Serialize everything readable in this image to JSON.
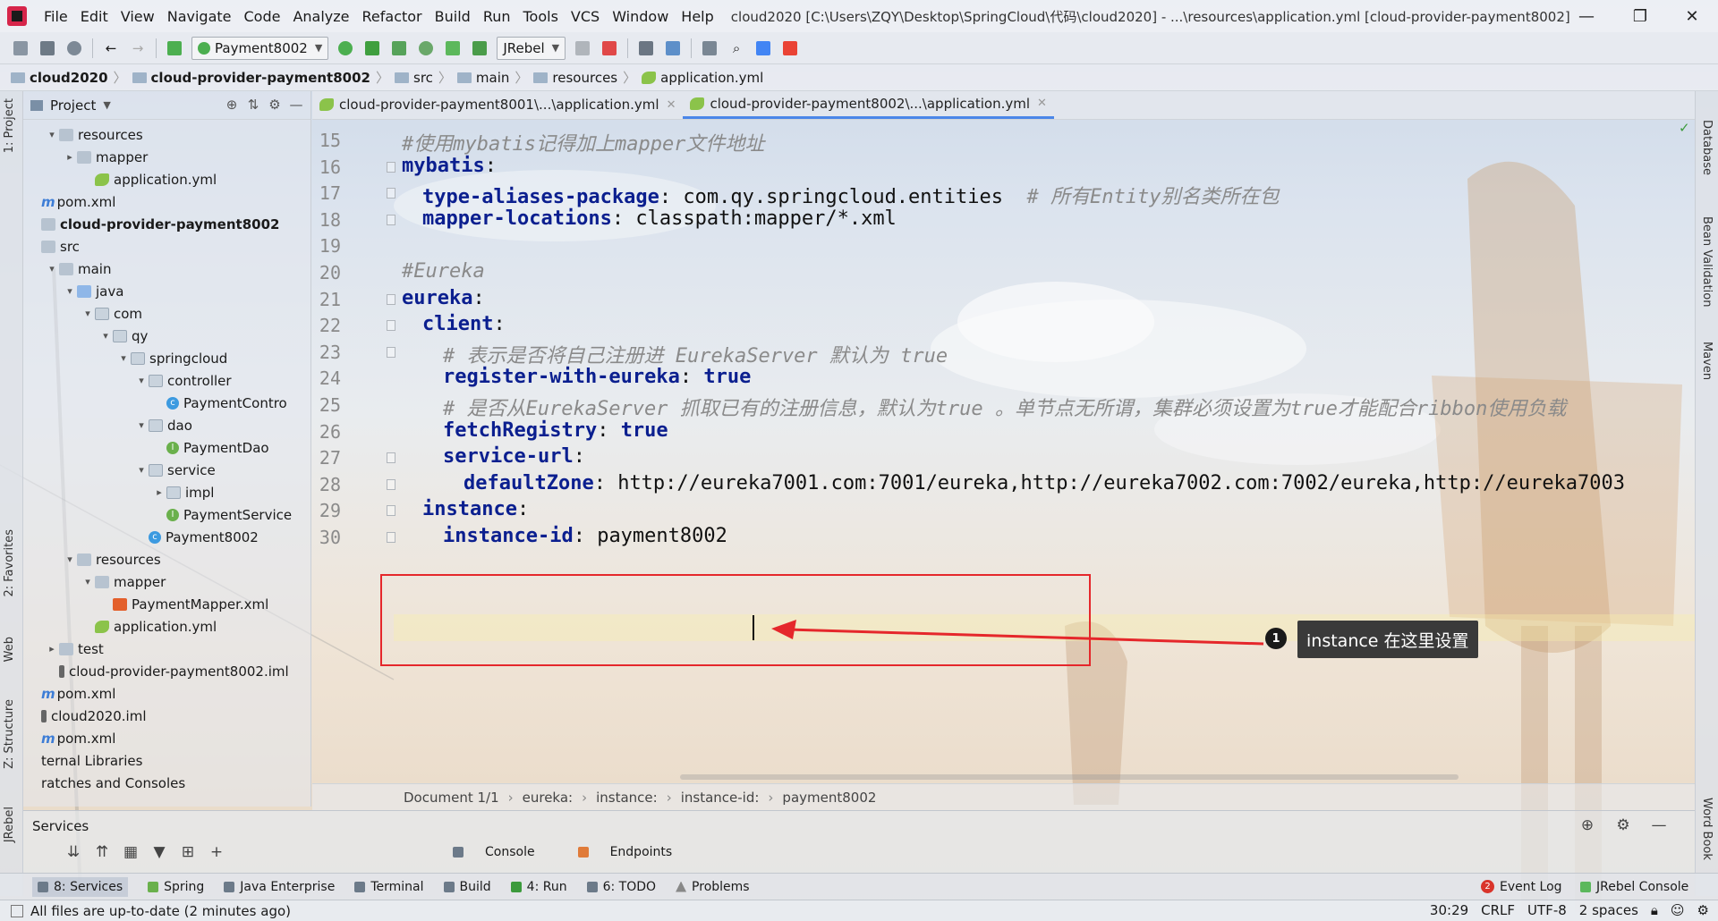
{
  "window": {
    "title": "cloud2020 [C:\\Users\\ZQY\\Desktop\\SpringCloud\\代码\\cloud2020] - ...\\resources\\application.yml [cloud-provider-payment8002]",
    "minimize": "—",
    "restore": "❐",
    "close": "✕"
  },
  "menu": [
    "File",
    "Edit",
    "View",
    "Navigate",
    "Code",
    "Analyze",
    "Refactor",
    "Build",
    "Run",
    "Tools",
    "VCS",
    "Window",
    "Help"
  ],
  "toolbar": {
    "run_config": "Payment8002",
    "jrebel_select": "JRebel"
  },
  "breadcrumb": [
    "cloud2020",
    "cloud-provider-payment8002",
    "src",
    "main",
    "resources",
    "application.yml"
  ],
  "left_stripe": [
    "1: Project",
    "2: Favorites",
    "Web",
    "Z: Structure",
    "JRebel"
  ],
  "right_stripe": [
    "Database",
    "Bean Validation",
    "Maven",
    "Word Book"
  ],
  "project_panel": {
    "title": "Project",
    "tree": [
      {
        "label": "resources",
        "depth": 1,
        "icon": "folder",
        "arrow": "down"
      },
      {
        "label": "mapper",
        "depth": 2,
        "icon": "folder",
        "arrow": "right"
      },
      {
        "label": "application.yml",
        "depth": 3,
        "icon": "yml",
        "arrow": ""
      },
      {
        "label": "pom.xml",
        "depth": 0,
        "icon": "m",
        "arrow": ""
      },
      {
        "label": "cloud-provider-payment8002",
        "depth": 0,
        "icon": "module",
        "arrow": "",
        "bold": true
      },
      {
        "label": "src",
        "depth": 0,
        "icon": "folder",
        "arrow": ""
      },
      {
        "label": "main",
        "depth": 1,
        "icon": "folder",
        "arrow": "down"
      },
      {
        "label": "java",
        "depth": 2,
        "icon": "src",
        "arrow": "down"
      },
      {
        "label": "com",
        "depth": 3,
        "icon": "pkg",
        "arrow": "down"
      },
      {
        "label": "qy",
        "depth": 4,
        "icon": "pkg",
        "arrow": "down"
      },
      {
        "label": "springcloud",
        "depth": 5,
        "icon": "pkg",
        "arrow": "down"
      },
      {
        "label": "controller",
        "depth": 6,
        "icon": "pkg",
        "arrow": "down"
      },
      {
        "label": "PaymentContro",
        "depth": 7,
        "icon": "c",
        "arrow": ""
      },
      {
        "label": "dao",
        "depth": 6,
        "icon": "pkg",
        "arrow": "down"
      },
      {
        "label": "PaymentDao",
        "depth": 7,
        "icon": "i",
        "arrow": ""
      },
      {
        "label": "service",
        "depth": 6,
        "icon": "pkg",
        "arrow": "down"
      },
      {
        "label": "impl",
        "depth": 7,
        "icon": "pkg",
        "arrow": "right"
      },
      {
        "label": "PaymentService",
        "depth": 7,
        "icon": "i",
        "arrow": ""
      },
      {
        "label": "Payment8002",
        "depth": 6,
        "icon": "c",
        "arrow": ""
      },
      {
        "label": "resources",
        "depth": 2,
        "icon": "folder",
        "arrow": "down"
      },
      {
        "label": "mapper",
        "depth": 3,
        "icon": "folder",
        "arrow": "down"
      },
      {
        "label": "PaymentMapper.xml",
        "depth": 4,
        "icon": "xml",
        "arrow": ""
      },
      {
        "label": "application.yml",
        "depth": 3,
        "icon": "yml",
        "arrow": ""
      },
      {
        "label": "test",
        "depth": 1,
        "icon": "folder",
        "arrow": "right"
      },
      {
        "label": "cloud-provider-payment8002.iml",
        "depth": 1,
        "icon": "iml",
        "arrow": ""
      },
      {
        "label": "pom.xml",
        "depth": 0,
        "icon": "m",
        "arrow": ""
      },
      {
        "label": "cloud2020.iml",
        "depth": 0,
        "icon": "iml",
        "arrow": ""
      },
      {
        "label": "pom.xml",
        "depth": 0,
        "icon": "m",
        "arrow": ""
      },
      {
        "label": "ternal Libraries",
        "depth": 0,
        "icon": "",
        "arrow": ""
      },
      {
        "label": "ratches and Consoles",
        "depth": 0,
        "icon": "",
        "arrow": ""
      }
    ]
  },
  "editor": {
    "tabs": [
      {
        "label": "cloud-provider-payment8001\\...\\application.yml",
        "active": false
      },
      {
        "label": "cloud-provider-payment8002\\...\\application.yml",
        "active": true
      }
    ],
    "lines": [
      {
        "n": "15",
        "indent": 0,
        "parts": [
          {
            "t": "#使用mybatis记得加上mapper文件地址",
            "c": "cm"
          }
        ]
      },
      {
        "n": "16",
        "indent": 0,
        "parts": [
          {
            "t": "mybatis",
            "c": "k"
          },
          {
            "t": ":",
            "c": ""
          }
        ]
      },
      {
        "n": "17",
        "indent": 1,
        "parts": [
          {
            "t": "type-aliases-package",
            "c": "k"
          },
          {
            "t": ": com.qy.springcloud.entities  ",
            "c": ""
          },
          {
            "t": "# 所有Entity别名类所在包",
            "c": "cm"
          }
        ]
      },
      {
        "n": "18",
        "indent": 1,
        "parts": [
          {
            "t": "mapper-locations",
            "c": "k"
          },
          {
            "t": ": classpath:mapper/*.xml",
            "c": ""
          }
        ]
      },
      {
        "n": "19",
        "indent": 0,
        "parts": []
      },
      {
        "n": "20",
        "indent": 0,
        "parts": [
          {
            "t": "#Eureka",
            "c": "cm"
          }
        ]
      },
      {
        "n": "21",
        "indent": 0,
        "parts": [
          {
            "t": "eureka",
            "c": "k"
          },
          {
            "t": ":",
            "c": ""
          }
        ]
      },
      {
        "n": "22",
        "indent": 1,
        "parts": [
          {
            "t": "client",
            "c": "k"
          },
          {
            "t": ":",
            "c": ""
          }
        ]
      },
      {
        "n": "23",
        "indent": 2,
        "parts": [
          {
            "t": "# 表示是否将自己注册进 EurekaServer 默认为 true",
            "c": "cm"
          }
        ]
      },
      {
        "n": "24",
        "indent": 2,
        "parts": [
          {
            "t": "register-with-eureka",
            "c": "k"
          },
          {
            "t": ": ",
            "c": ""
          },
          {
            "t": "true",
            "c": "k"
          }
        ]
      },
      {
        "n": "25",
        "indent": 2,
        "parts": [
          {
            "t": "# 是否从EurekaServer 抓取已有的注册信息，默认为true 。单节点无所谓，集群必须设置为true才能配合ribbon使用负载",
            "c": "cm"
          }
        ]
      },
      {
        "n": "26",
        "indent": 2,
        "parts": [
          {
            "t": "fetchRegistry",
            "c": "k"
          },
          {
            "t": ": ",
            "c": ""
          },
          {
            "t": "true",
            "c": "k"
          }
        ]
      },
      {
        "n": "27",
        "indent": 2,
        "parts": [
          {
            "t": "service-url",
            "c": "k"
          },
          {
            "t": ":",
            "c": ""
          }
        ]
      },
      {
        "n": "28",
        "indent": 3,
        "parts": [
          {
            "t": "defaultZone",
            "c": "k"
          },
          {
            "t": ": http://eureka7001.com:7001/eureka,http://eureka7002.com:7002/eureka,http://eureka7003",
            "c": ""
          }
        ]
      },
      {
        "n": "29",
        "indent": 1,
        "parts": [
          {
            "t": "instance",
            "c": "k"
          },
          {
            "t": ":",
            "c": ""
          }
        ]
      },
      {
        "n": "30",
        "indent": 2,
        "parts": [
          {
            "t": "instance-id",
            "c": "k"
          },
          {
            "t": ": payment8002",
            "c": ""
          }
        ]
      }
    ],
    "annotation": {
      "number": "1",
      "text": "instance 在这里设置"
    },
    "breadcrumb": [
      "Document 1/1",
      "eureka:",
      "instance:",
      "instance-id:",
      "payment8002"
    ]
  },
  "services": {
    "title": "Services",
    "tabs": [
      "Console",
      "Endpoints"
    ]
  },
  "tool_windows": [
    "8: Services",
    "Spring",
    "Java Enterprise",
    "Terminal",
    "Build",
    "4: Run",
    "6: TODO",
    "Problems"
  ],
  "tool_windows_right": {
    "event_log": "Event Log",
    "event_count": "2",
    "jrebel_console": "JRebel Console"
  },
  "status": {
    "message": "All files are up-to-date (2 minutes ago)",
    "position": "30:29",
    "line_sep": "CRLF",
    "encoding": "UTF-8",
    "indent": "2 spaces"
  },
  "colors": {
    "accent": "#4a86e8",
    "annotation_red": "#e5272b",
    "keyword": "#0b1f8f",
    "comment": "#8a8a8a"
  }
}
